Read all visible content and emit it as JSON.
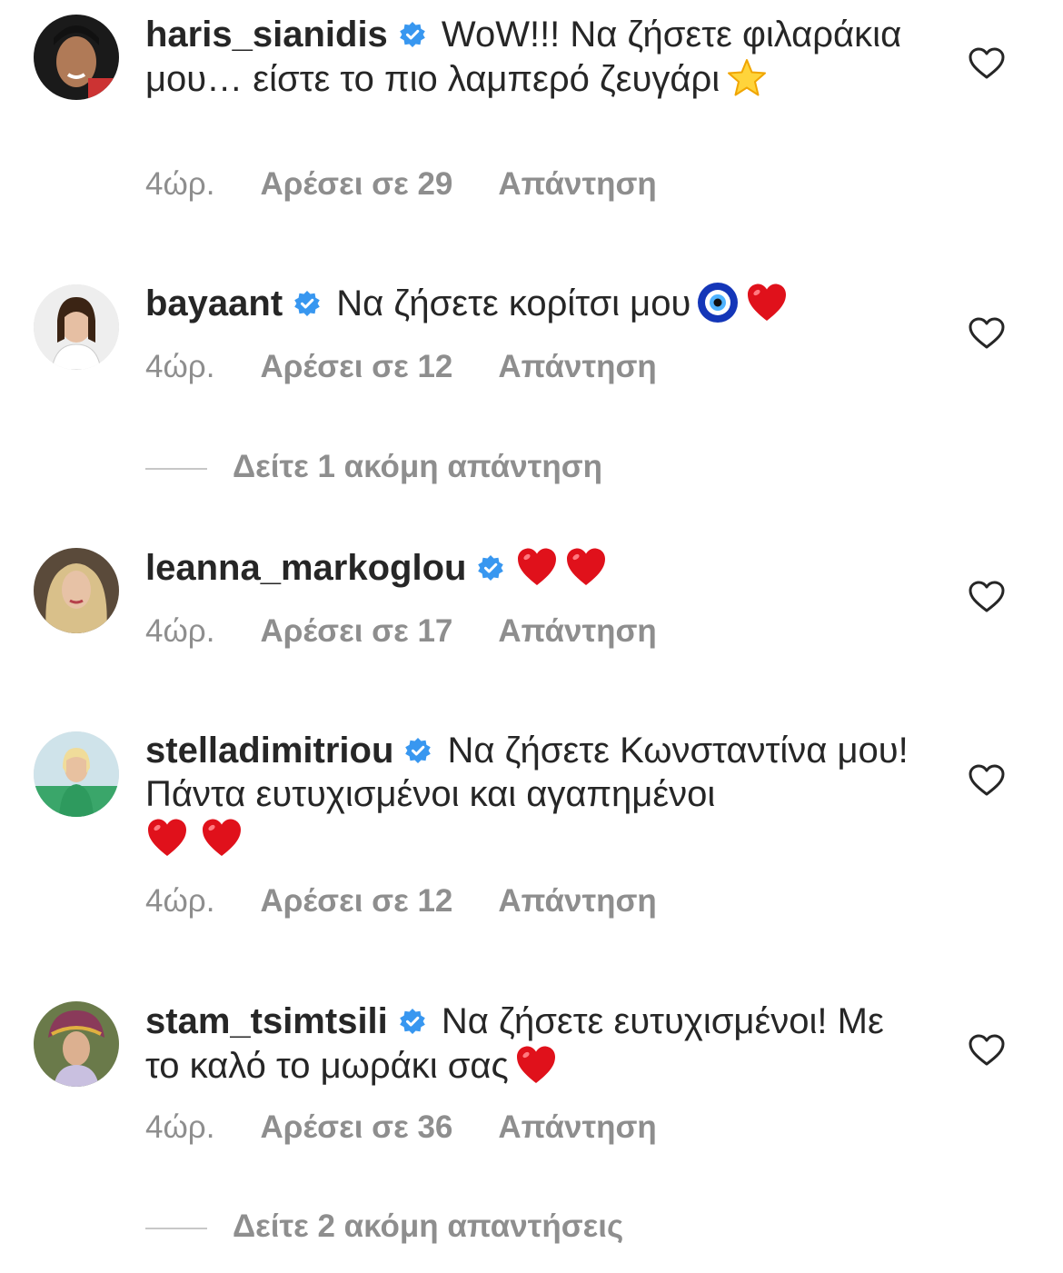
{
  "ui": {
    "verified_color": "#3897f0",
    "muted_color": "#8e8e8e",
    "text_color": "#262626"
  },
  "comments": [
    {
      "username": "haris_sianidis",
      "text": "WoW!!! Να ζήσετε φιλαράκια μου… είστε το πιο λαμπερό ζευγάρι",
      "emojis": [
        "star"
      ],
      "time": "4ώρ.",
      "likes": "Αρέσει σε 29",
      "reply": "Απάντηση"
    },
    {
      "username": "bayaant",
      "text": "Να ζήσετε κορίτσι μου",
      "emojis": [
        "nazar-amulet",
        "red-heart"
      ],
      "time": "4ώρ.",
      "likes": "Αρέσει σε 12",
      "reply": "Απάντηση",
      "more_replies": "Δείτε 1 ακόμη απάντηση"
    },
    {
      "username": "leanna_markoglou",
      "text": "",
      "emojis": [
        "red-heart",
        "red-heart"
      ],
      "time": "4ώρ.",
      "likes": "Αρέσει σε 17",
      "reply": "Απάντηση"
    },
    {
      "username": "stelladimitriou",
      "text": "Να ζήσετε Κωνσταντίνα μου! Πάντα ευτυχισμένοι και αγαπημένοι",
      "emojis": [
        "red-heart",
        "red-heart"
      ],
      "time": "4ώρ.",
      "likes": "Αρέσει σε 12",
      "reply": "Απάντηση"
    },
    {
      "username": "stam_tsimtsili",
      "text": "Να ζήσετε ευτυχισμένοι! Με το καλό το μωράκι σας",
      "emojis": [
        "red-heart"
      ],
      "time": "4ώρ.",
      "likes": "Αρέσει σε 36",
      "reply": "Απάντηση",
      "more_replies": "Δείτε 2 ακόμη απαντήσεις"
    }
  ]
}
